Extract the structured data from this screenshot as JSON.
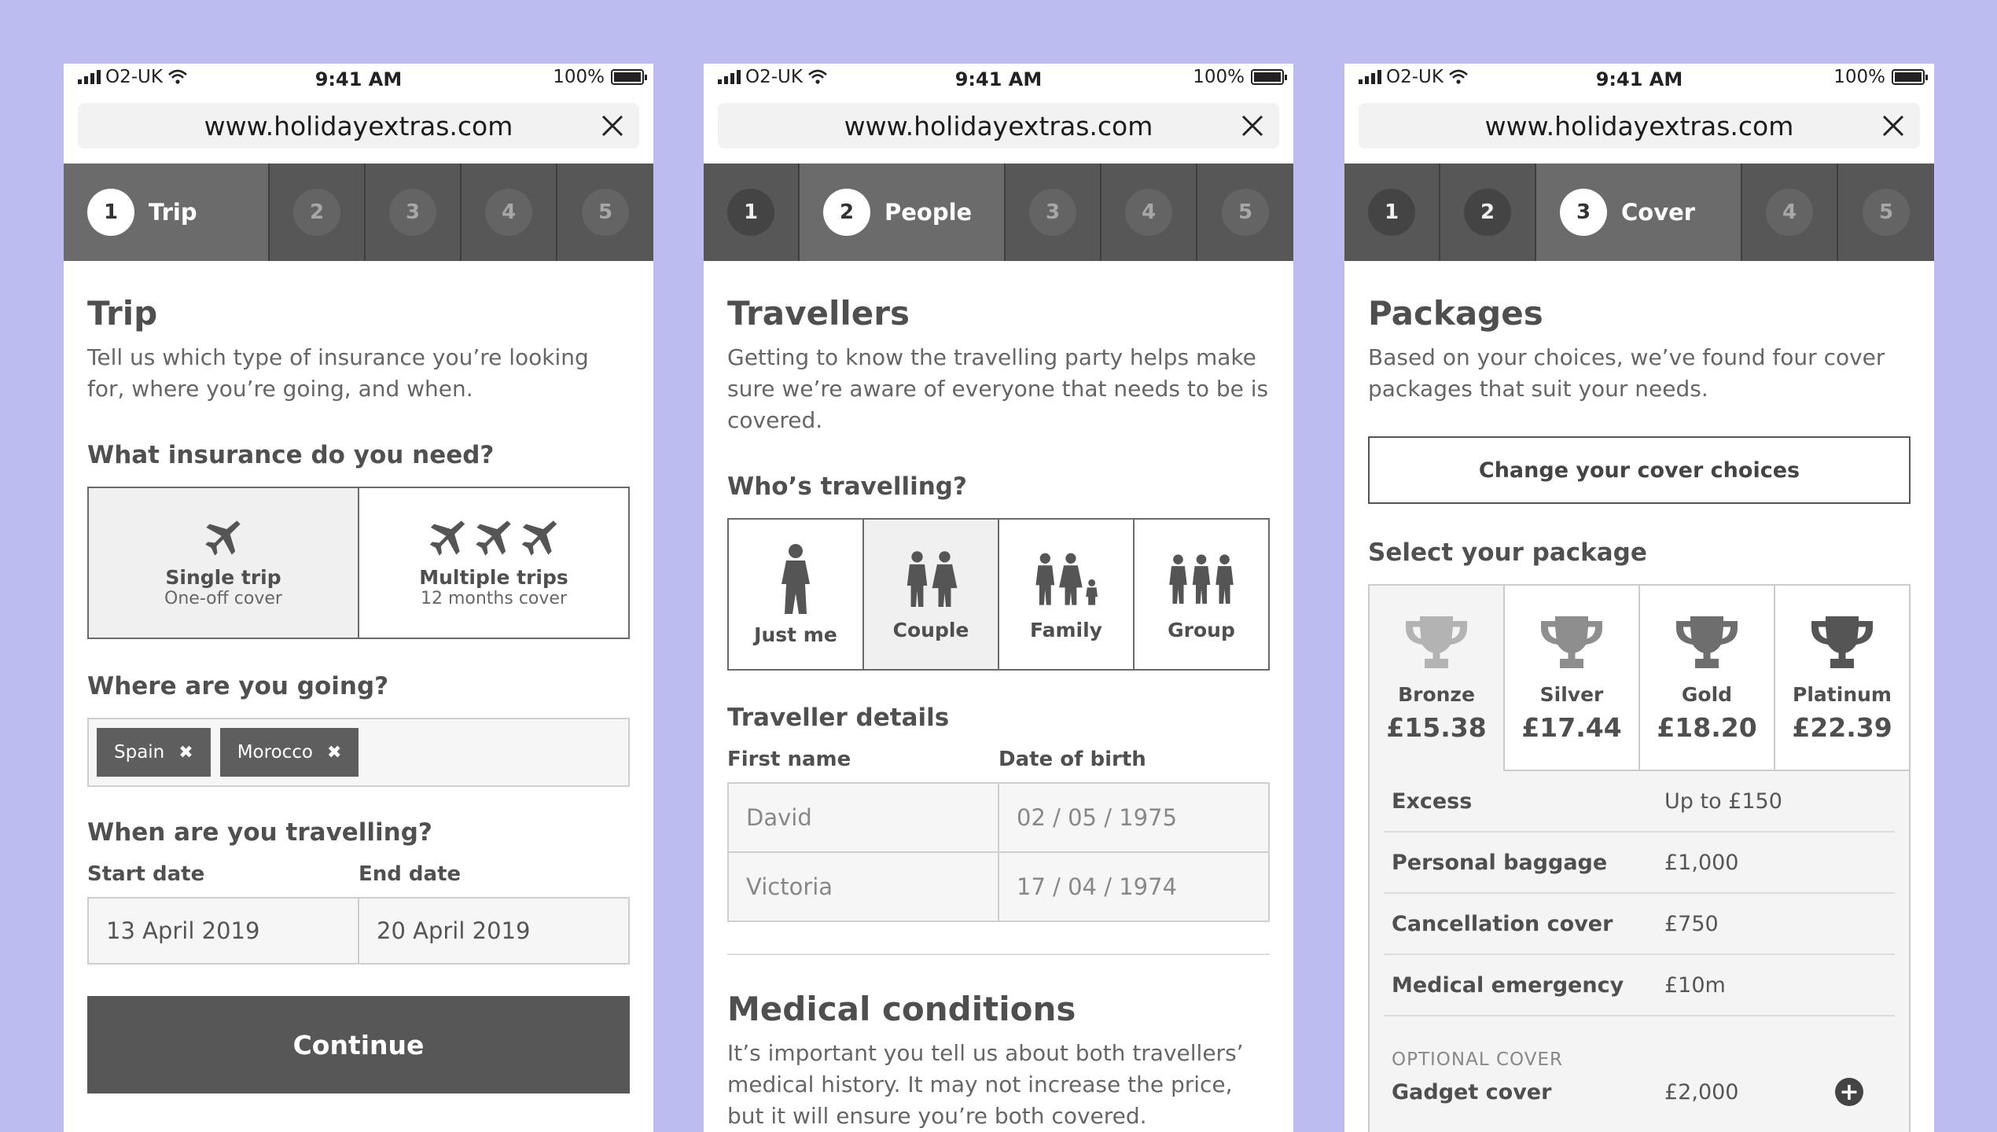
{
  "status": {
    "carrier": "O2-UK",
    "time": "9:41 AM",
    "battery": "100%"
  },
  "url": "www.holidayextras.com",
  "screen1": {
    "steps": [
      "1",
      "2",
      "3",
      "4",
      "5"
    ],
    "active_label": "Trip",
    "title": "Trip",
    "intro": "Tell us which type of insurance you’re looking for, where you’re going, and when.",
    "q_insurance": "What insurance do you need?",
    "options": [
      {
        "title": "Single trip",
        "subtitle": "One-off cover",
        "icon": "plane-icon"
      },
      {
        "title": "Multiple trips",
        "subtitle": "12 months cover",
        "icon": "three-planes-icon"
      }
    ],
    "q_where": "Where are you going?",
    "destinations": [
      "Spain",
      "Morocco"
    ],
    "q_when": "When are you travelling?",
    "start_label": "Start date",
    "end_label": "End date",
    "start_date": "13 April 2019",
    "end_date": "20 April 2019",
    "continue": "Continue"
  },
  "screen2": {
    "active_label": "People",
    "title": "Travellers",
    "intro": "Getting to know the travelling party helps make sure we’re aware of everyone that needs to be is covered.",
    "q_who": "Who’s travelling?",
    "party": [
      {
        "label": "Just me",
        "icon": "person-icon"
      },
      {
        "label": "Couple",
        "icon": "couple-icon"
      },
      {
        "label": "Family",
        "icon": "family-icon"
      },
      {
        "label": "Group",
        "icon": "group-icon"
      }
    ],
    "details_title": "Traveller details",
    "first_name_label": "First name",
    "dob_label": "Date of birth",
    "travellers": [
      {
        "name": "David",
        "dob": "02 / 05 / 1975"
      },
      {
        "name": "Victoria",
        "dob": "17 / 04 / 1974"
      }
    ],
    "medical_title": "Medical conditions",
    "medical_text": "It’s important you tell us about both travellers’ medical history. It may not increase the price, but it will ensure you’re both covered."
  },
  "screen3": {
    "active_label": "Cover",
    "title": "Packages",
    "intro": "Based on your choices, we’ve found four cover packages that suit your needs.",
    "change_btn": "Change your cover choices",
    "select_title": "Select your package",
    "packages": [
      {
        "name": "Bronze",
        "price": "£15.38",
        "color": "#b3b3b3"
      },
      {
        "name": "Silver",
        "price": "£17.44",
        "color": "#8e8e8e"
      },
      {
        "name": "Gold",
        "price": "£18.20",
        "color": "#6e6e6e"
      },
      {
        "name": "Platinum",
        "price": "£22.39",
        "color": "#555555"
      }
    ],
    "rows": [
      {
        "k": "Excess",
        "v": "Up to £150"
      },
      {
        "k": "Personal baggage",
        "v": "£1,000"
      },
      {
        "k": "Cancellation cover",
        "v": "£750"
      },
      {
        "k": "Medical emergency",
        "v": "£10m"
      }
    ],
    "optional_label": "OPTIONAL COVER",
    "gadget": {
      "k": "Gadget cover",
      "v": "£2,000"
    }
  }
}
